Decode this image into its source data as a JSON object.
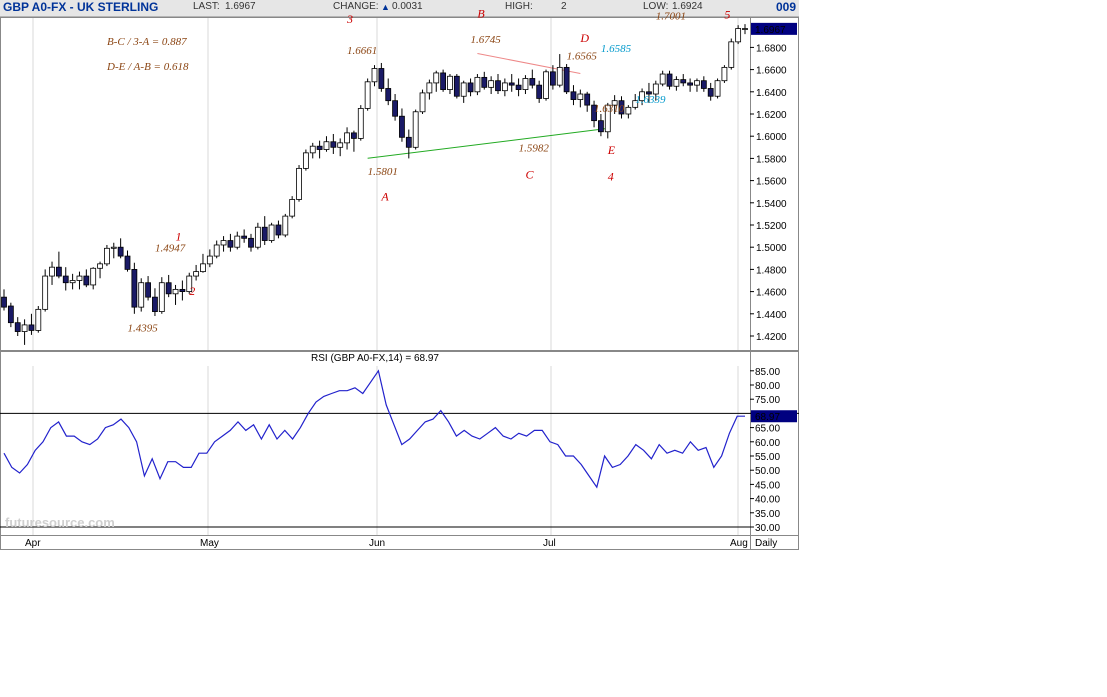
{
  "header": {
    "symbol": "GBP A0-FX - UK STERLING",
    "last_label": "LAST:",
    "last_value": "1.6967",
    "change_label": "CHANGE:",
    "change_value": "0.0031",
    "change_icon": "up-triangle-icon",
    "high_label": "HIGH:",
    "high_value": "2",
    "low_label": "LOW:",
    "low_value": "1.6924",
    "code": "009"
  },
  "watermark": "futuresource.com",
  "colors": {
    "candle": "#1a1a66",
    "rsi_line": "#2222cc",
    "annotation_brown": "#8b4513",
    "annotation_red": "#cc0000",
    "annotation_cyan": "#0099cc",
    "trendline_green": "#22aa22",
    "trendline_pink": "#ee8888",
    "last_badge": "#000080"
  },
  "chart_data": [
    {
      "type": "candlestick",
      "title": "GBP A0-FX - UK STERLING",
      "ylim": [
        1.4,
        1.71
      ],
      "y_ticks": [
        "1.6800",
        "1.6600",
        "1.6400",
        "1.6200",
        "1.6000",
        "1.5800",
        "1.5600",
        "1.5400",
        "1.5200",
        "1.5000",
        "1.4800",
        "1.4600",
        "1.4400",
        "1.4200"
      ],
      "x_ticks": [
        "Apr",
        "May",
        "Jun",
        "Jul",
        "Aug",
        "Daily"
      ],
      "last_price": "1.6967",
      "series": [
        {
          "candles": [
            [
              1.455,
              1.462,
              1.443,
              1.446
            ],
            [
              1.447,
              1.45,
              1.428,
              1.432
            ],
            [
              1.432,
              1.437,
              1.42,
              1.424
            ],
            [
              1.424,
              1.435,
              1.412,
              1.43
            ],
            [
              1.43,
              1.44,
              1.421,
              1.425
            ],
            [
              1.425,
              1.447,
              1.423,
              1.444
            ],
            [
              1.444,
              1.48,
              1.442,
              1.474
            ],
            [
              1.474,
              1.487,
              1.466,
              1.482
            ],
            [
              1.482,
              1.496,
              1.472,
              1.474
            ],
            [
              1.474,
              1.482,
              1.461,
              1.468
            ],
            [
              1.468,
              1.476,
              1.462,
              1.47
            ],
            [
              1.47,
              1.478,
              1.462,
              1.474
            ],
            [
              1.474,
              1.48,
              1.464,
              1.466
            ],
            [
              1.466,
              1.482,
              1.462,
              1.481
            ],
            [
              1.481,
              1.487,
              1.472,
              1.485
            ],
            [
              1.485,
              1.502,
              1.483,
              1.499
            ],
            [
              1.499,
              1.504,
              1.49,
              1.5
            ],
            [
              1.5,
              1.508,
              1.49,
              1.492
            ],
            [
              1.492,
              1.497,
              1.478,
              1.48
            ],
            [
              1.48,
              1.486,
              1.44,
              1.446
            ],
            [
              1.446,
              1.472,
              1.442,
              1.468
            ],
            [
              1.468,
              1.474,
              1.452,
              1.455
            ],
            [
              1.455,
              1.463,
              1.438,
              1.442
            ],
            [
              1.442,
              1.473,
              1.44,
              1.468
            ],
            [
              1.468,
              1.475,
              1.455,
              1.458
            ],
            [
              1.458,
              1.466,
              1.448,
              1.462
            ],
            [
              1.462,
              1.47,
              1.452,
              1.46
            ],
            [
              1.46,
              1.477,
              1.458,
              1.474
            ],
            [
              1.474,
              1.484,
              1.47,
              1.478
            ],
            [
              1.478,
              1.494,
              1.477,
              1.485
            ],
            [
              1.485,
              1.498,
              1.482,
              1.492
            ],
            [
              1.492,
              1.506,
              1.49,
              1.502
            ],
            [
              1.502,
              1.51,
              1.496,
              1.506
            ],
            [
              1.506,
              1.512,
              1.496,
              1.5
            ],
            [
              1.5,
              1.514,
              1.498,
              1.51
            ],
            [
              1.51,
              1.516,
              1.504,
              1.508
            ],
            [
              1.508,
              1.512,
              1.496,
              1.5
            ],
            [
              1.5,
              1.522,
              1.498,
              1.518
            ],
            [
              1.518,
              1.528,
              1.502,
              1.506
            ],
            [
              1.506,
              1.522,
              1.504,
              1.52
            ],
            [
              1.52,
              1.524,
              1.508,
              1.511
            ],
            [
              1.511,
              1.53,
              1.509,
              1.528
            ],
            [
              1.528,
              1.546,
              1.526,
              1.543
            ],
            [
              1.543,
              1.574,
              1.541,
              1.571
            ],
            [
              1.571,
              1.588,
              1.569,
              1.585
            ],
            [
              1.585,
              1.594,
              1.58,
              1.591
            ],
            [
              1.591,
              1.596,
              1.58,
              1.588
            ],
            [
              1.588,
              1.6,
              1.586,
              1.595
            ],
            [
              1.595,
              1.602,
              1.584,
              1.59
            ],
            [
              1.59,
              1.598,
              1.582,
              1.594
            ],
            [
              1.594,
              1.608,
              1.588,
              1.603
            ],
            [
              1.603,
              1.605,
              1.586,
              1.598
            ],
            [
              1.598,
              1.628,
              1.596,
              1.625
            ],
            [
              1.625,
              1.652,
              1.623,
              1.649
            ],
            [
              1.649,
              1.664,
              1.645,
              1.661
            ],
            [
              1.661,
              1.666,
              1.64,
              1.643
            ],
            [
              1.643,
              1.652,
              1.628,
              1.632
            ],
            [
              1.632,
              1.638,
              1.614,
              1.618
            ],
            [
              1.618,
              1.625,
              1.595,
              1.599
            ],
            [
              1.599,
              1.606,
              1.58,
              1.59
            ],
            [
              1.59,
              1.624,
              1.588,
              1.622
            ],
            [
              1.622,
              1.642,
              1.62,
              1.639
            ],
            [
              1.639,
              1.651,
              1.633,
              1.648
            ],
            [
              1.648,
              1.659,
              1.64,
              1.657
            ],
            [
              1.657,
              1.66,
              1.64,
              1.642
            ],
            [
              1.642,
              1.656,
              1.638,
              1.654
            ],
            [
              1.654,
              1.656,
              1.634,
              1.636
            ],
            [
              1.636,
              1.65,
              1.63,
              1.648
            ],
            [
              1.648,
              1.652,
              1.636,
              1.64
            ],
            [
              1.64,
              1.656,
              1.637,
              1.653
            ],
            [
              1.653,
              1.658,
              1.642,
              1.644
            ],
            [
              1.644,
              1.654,
              1.638,
              1.65
            ],
            [
              1.65,
              1.656,
              1.638,
              1.641
            ],
            [
              1.641,
              1.652,
              1.636,
              1.648
            ],
            [
              1.648,
              1.656,
              1.64,
              1.646
            ],
            [
              1.646,
              1.652,
              1.636,
              1.642
            ],
            [
              1.642,
              1.655,
              1.638,
              1.652
            ],
            [
              1.652,
              1.66,
              1.643,
              1.646
            ],
            [
              1.646,
              1.65,
              1.63,
              1.634
            ],
            [
              1.634,
              1.66,
              1.632,
              1.658
            ],
            [
              1.658,
              1.664,
              1.642,
              1.646
            ],
            [
              1.646,
              1.674,
              1.644,
              1.662
            ],
            [
              1.662,
              1.665,
              1.638,
              1.64
            ],
            [
              1.64,
              1.646,
              1.628,
              1.633
            ],
            [
              1.633,
              1.642,
              1.626,
              1.638
            ],
            [
              1.638,
              1.64,
              1.622,
              1.628
            ],
            [
              1.628,
              1.632,
              1.608,
              1.614
            ],
            [
              1.614,
              1.62,
              1.6,
              1.604
            ],
            [
              1.604,
              1.63,
              1.598,
              1.628
            ],
            [
              1.628,
              1.637,
              1.62,
              1.632
            ],
            [
              1.632,
              1.636,
              1.616,
              1.62
            ],
            [
              1.62,
              1.628,
              1.616,
              1.626
            ],
            [
              1.626,
              1.638,
              1.624,
              1.632
            ],
            [
              1.632,
              1.643,
              1.628,
              1.64
            ],
            [
              1.64,
              1.648,
              1.63,
              1.638
            ],
            [
              1.638,
              1.65,
              1.632,
              1.647
            ],
            [
              1.647,
              1.659,
              1.645,
              1.656
            ],
            [
              1.656,
              1.659,
              1.642,
              1.645
            ],
            [
              1.645,
              1.654,
              1.641,
              1.651
            ],
            [
              1.651,
              1.656,
              1.645,
              1.648
            ],
            [
              1.648,
              1.652,
              1.64,
              1.646
            ],
            [
              1.646,
              1.652,
              1.64,
              1.65
            ],
            [
              1.65,
              1.654,
              1.64,
              1.643
            ],
            [
              1.643,
              1.648,
              1.632,
              1.636
            ],
            [
              1.636,
              1.652,
              1.634,
              1.65
            ],
            [
              1.65,
              1.664,
              1.648,
              1.662
            ],
            [
              1.662,
              1.688,
              1.66,
              1.685
            ],
            [
              1.685,
              1.7,
              1.683,
              1.697
            ],
            [
              1.697,
              1.701,
              1.692,
              1.697
            ]
          ]
        }
      ]
    },
    {
      "type": "line",
      "title": "RSI (GBP A0-FX,14) = 68.97",
      "ylim": [
        30,
        85
      ],
      "y_ticks": [
        "85.00",
        "80.00",
        "75.00",
        "70.00",
        "65.00",
        "60.00",
        "55.00",
        "50.00",
        "45.00",
        "40.00",
        "35.00",
        "30.00"
      ],
      "last_value": "68.97",
      "series": [
        {
          "name": "RSI",
          "values": [
            56,
            51,
            49,
            52,
            57,
            60,
            65,
            67,
            62,
            62,
            60,
            59,
            61,
            65,
            66,
            68,
            65,
            60,
            48,
            54,
            47,
            53,
            53,
            51,
            51,
            56,
            56,
            60,
            62,
            64,
            67,
            64,
            66,
            61,
            66,
            61,
            64,
            61,
            65,
            70,
            74,
            76,
            77,
            78,
            78,
            79,
            77,
            81,
            85,
            73,
            66,
            59,
            61,
            64,
            67,
            68,
            71,
            67,
            62,
            64,
            62,
            61,
            63,
            65,
            62,
            61,
            63,
            62,
            64,
            64,
            60,
            59,
            55,
            55,
            52,
            48,
            44,
            55,
            51,
            52,
            55,
            59,
            57,
            54,
            59,
            56,
            57,
            56,
            60,
            57,
            58,
            51,
            55,
            63,
            69,
            69
          ]
        }
      ]
    }
  ],
  "annotations": {
    "wave_labels": [
      {
        "text": "1",
        "price": 1.506,
        "idx": 25
      },
      {
        "text": "2",
        "price": 1.457,
        "idx": 27
      },
      {
        "text": "3",
        "price": 1.702,
        "idx": 50
      },
      {
        "text": "4",
        "price": 1.56,
        "idx": 88
      },
      {
        "text": "5",
        "price": 1.706,
        "idx": 105
      },
      {
        "text": "A",
        "price": 1.542,
        "idx": 55
      },
      {
        "text": "B",
        "price": 1.707,
        "idx": 69
      },
      {
        "text": "C",
        "price": 1.562,
        "idx": 76
      },
      {
        "text": "D",
        "price": 1.685,
        "idx": 84
      },
      {
        "text": "E",
        "price": 1.584,
        "idx": 88
      }
    ],
    "price_labels": [
      {
        "text": "1.4947",
        "price": 1.496,
        "idx": 22,
        "color": "brown"
      },
      {
        "text": "1.4395",
        "price": 1.424,
        "idx": 18,
        "color": "brown"
      },
      {
        "text": "1.6661",
        "price": 1.674,
        "idx": 50,
        "color": "brown"
      },
      {
        "text": "1.5801",
        "price": 1.565,
        "idx": 53,
        "color": "brown"
      },
      {
        "text": "1.6745",
        "price": 1.684,
        "idx": 68,
        "color": "brown"
      },
      {
        "text": "1.5982",
        "price": 1.586,
        "idx": 75,
        "color": "brown"
      },
      {
        "text": "1.6565",
        "price": 1.669,
        "idx": 82,
        "color": "brown"
      },
      {
        "text": "1.6310",
        "price": 1.622,
        "idx": 86,
        "color": "brown"
      },
      {
        "text": "1.6585",
        "price": 1.676,
        "idx": 87,
        "color": "cyan"
      },
      {
        "text": "1.6339",
        "price": 1.63,
        "idx": 92,
        "color": "cyan"
      },
      {
        "text": "1.7001",
        "price": 1.705,
        "idx": 95,
        "color": "brown"
      }
    ],
    "ratios": [
      "B-C / 3-A  = 0.887",
      "D-E / A-B = 0.618"
    ]
  }
}
